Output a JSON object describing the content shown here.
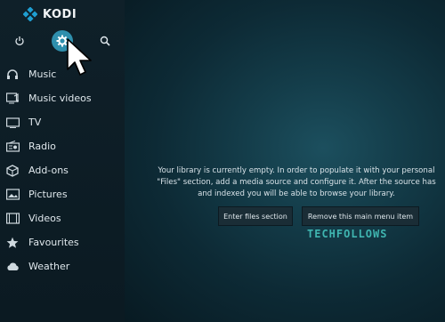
{
  "app": {
    "title": "KODI"
  },
  "top_buttons": [
    {
      "name": "power-icon",
      "tooltip": ""
    },
    {
      "name": "gear-icon",
      "tooltip": ""
    },
    {
      "name": "search-icon",
      "tooltip": ""
    }
  ],
  "sidebar": {
    "items": [
      {
        "label": "Music",
        "icon": "headphones-icon"
      },
      {
        "label": "Music videos",
        "icon": "music-video-icon"
      },
      {
        "label": "TV",
        "icon": "tv-icon"
      },
      {
        "label": "Radio",
        "icon": "radio-icon"
      },
      {
        "label": "Add-ons",
        "icon": "addons-icon"
      },
      {
        "label": "Pictures",
        "icon": "pictures-icon"
      },
      {
        "label": "Videos",
        "icon": "film-icon"
      },
      {
        "label": "Favourites",
        "icon": "star-icon"
      },
      {
        "label": "Weather",
        "icon": "cloud-icon"
      }
    ]
  },
  "main": {
    "message_line1": "Your library is currently empty. In order to populate it with your personal",
    "message_line2": "\"Files\" section, add a media source and configure it. After the source has",
    "message_line3": "and indexed you will be able to browse your library.",
    "enter_files_label": "Enter files section",
    "remove_item_label": "Remove this main menu item"
  },
  "watermark": {
    "text": "TECHFOLLOWS"
  },
  "colors": {
    "accent": "#2f8fad",
    "watermark": "#3fb5b0"
  }
}
